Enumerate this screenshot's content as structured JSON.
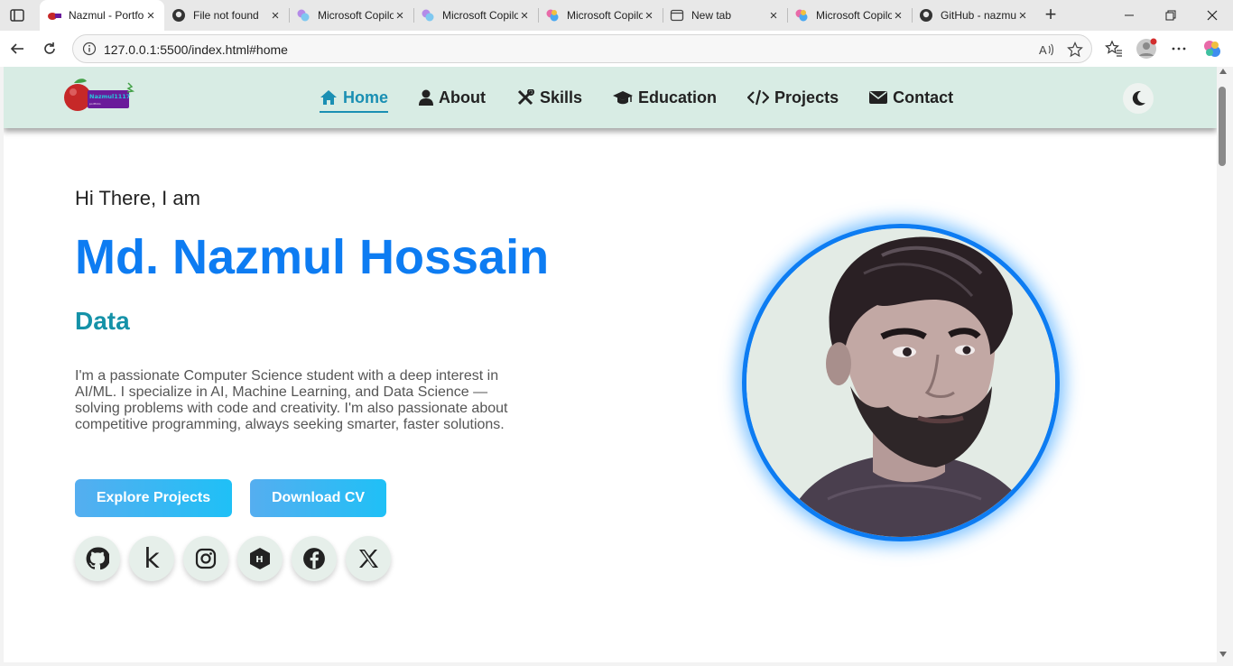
{
  "browser": {
    "tabs": [
      {
        "title": "Nazmul - Portfolio",
        "favicon": "apple-logo-icon",
        "active": true
      },
      {
        "title": "File not found",
        "favicon": "github-icon",
        "active": false
      },
      {
        "title": "Microsoft Copilot",
        "favicon": "copilot-icon",
        "active": false
      },
      {
        "title": "Microsoft Copilot",
        "favicon": "copilot-icon",
        "active": false
      },
      {
        "title": "Microsoft Copilot",
        "favicon": "copilot-icon",
        "active": false
      },
      {
        "title": "New tab",
        "favicon": "newtab-icon",
        "active": false
      },
      {
        "title": "Microsoft Copilot",
        "favicon": "copilot-icon",
        "active": false
      },
      {
        "title": "GitHub - nazmul",
        "favicon": "github-icon",
        "active": false
      }
    ],
    "url": "127.0.0.1:5500/index.html#home"
  },
  "site": {
    "logo_text": "Nazmul1117",
    "nav": [
      {
        "label": "Home",
        "icon": "home-icon",
        "active": true
      },
      {
        "label": "About",
        "icon": "user-icon",
        "active": false
      },
      {
        "label": "Skills",
        "icon": "tools-icon",
        "active": false
      },
      {
        "label": "Education",
        "icon": "graduation-cap-icon",
        "active": false
      },
      {
        "label": "Projects",
        "icon": "code-icon",
        "active": false
      },
      {
        "label": "Contact",
        "icon": "envelope-icon",
        "active": false
      }
    ],
    "theme_toggle_icon": "moon-icon"
  },
  "hero": {
    "greeting": "Hi There, I am",
    "name": "Md. Nazmul Hossain",
    "role": "Data",
    "description": "I'm a passionate Computer Science student with a deep interest in AI/ML. I specialize in AI, Machine Learning, and Data Science — solving problems with code and creativity. I'm also passionate about competitive programming, always seeking smarter, faster solutions.",
    "buttons": {
      "explore": "Explore Projects",
      "download": "Download CV"
    },
    "socials": [
      {
        "name": "github-icon"
      },
      {
        "name": "kaggle-icon",
        "glyph": "k"
      },
      {
        "name": "instagram-icon"
      },
      {
        "name": "hackerrank-icon"
      },
      {
        "name": "facebook-icon"
      },
      {
        "name": "x-icon"
      }
    ]
  },
  "colors": {
    "accent": "#0d7cf2",
    "role": "#1592a8",
    "nav_bg": "#d8ece4",
    "button": "#1fc0f6"
  }
}
